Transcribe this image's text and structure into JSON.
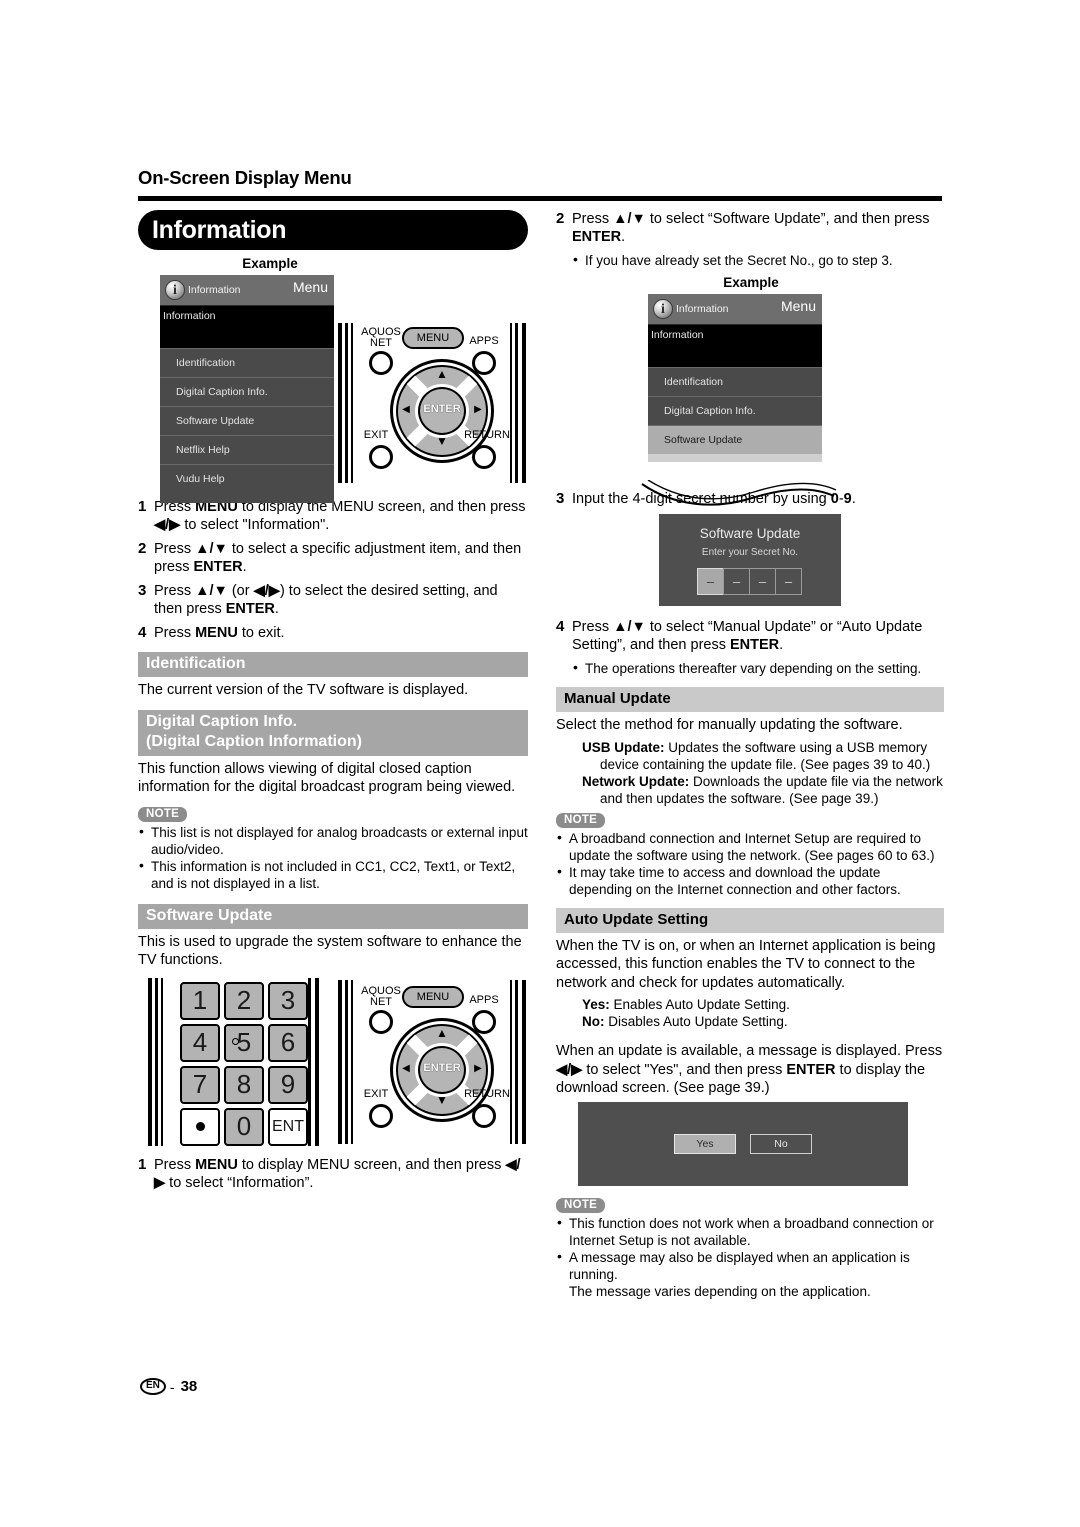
{
  "header": {
    "running_head": "On-Screen Display Menu"
  },
  "banner": {
    "title": "Information"
  },
  "labels": {
    "example": "Example",
    "note": "NOTE"
  },
  "osd_left": {
    "title_item": "Information",
    "title_menu": "Menu",
    "black_row": "Information",
    "rows": [
      "Identification",
      "Digital Caption Info.",
      "Software Update",
      "Netflix Help",
      "Vudu Help"
    ],
    "selected_index": -1
  },
  "osd_right": {
    "title_item": "Information",
    "title_menu": "Menu",
    "black_row": "Information",
    "rows": [
      "Identification",
      "Digital Caption Info.",
      "Software Update"
    ],
    "selected_index": 2
  },
  "remote": {
    "aquos_net_line1": "AQUOS",
    "aquos_net_line2": "NET",
    "menu": "MENU",
    "apps": "APPS",
    "exit": "EXIT",
    "return": "RETURN",
    "enter": "ENTER",
    "up_arrow": "▲",
    "down_arrow": "▼",
    "left_arrow": "◀",
    "right_arrow": "▶"
  },
  "keypad": {
    "keys": [
      "1",
      "2",
      "3",
      "4",
      "5",
      "6",
      "7",
      "8",
      "9",
      "•",
      "0",
      "ENT"
    ]
  },
  "left_steps": [
    {
      "num": "1",
      "text": "Press MENU to display the MENU screen, and then press ◀/▶ to select \"Information\"."
    },
    {
      "num": "2",
      "text": "Press ▲/▼ to select a specific adjustment item, and then press ENTER."
    },
    {
      "num": "3",
      "text": "Press ▲/▼ (or ◀/▶) to select the desired setting, and then press ENTER."
    },
    {
      "num": "4",
      "text": "Press MENU to exit."
    }
  ],
  "identification": {
    "heading": "Identification",
    "body": "The current version of the TV software is displayed."
  },
  "digital_caption": {
    "heading_line1": "Digital Caption Info.",
    "heading_line2": "(Digital Caption Information)",
    "body": "This function allows viewing of digital closed caption information for the digital broadcast program being viewed.",
    "notes": [
      "This list is not displayed for analog broadcasts or external input audio/video.",
      "This information is not included in CC1, CC2, Text1, or Text2, and is not displayed in a list."
    ]
  },
  "software_update_left": {
    "heading": "Software Update",
    "body": "This is used to upgrade the system software to enhance the TV functions.",
    "step": {
      "num": "1",
      "text": "Press MENU to display MENU screen, and then press ◀/▶ to select “Information”."
    }
  },
  "right_steps": {
    "step2": {
      "num": "2",
      "text": "Press ▲/▼ to select “Software Update”, and then press ENTER.",
      "bullet": "If you have already set the Secret No., go to step 3."
    },
    "step3": {
      "num": "3",
      "text": "Input the 4-digit secret number by using 0-9."
    },
    "step4": {
      "num": "4",
      "text": "Press ▲/▼ to select “Manual Update” or “Auto Update Setting”, and then press ENTER.",
      "bullet": "The operations thereafter vary depending on the setting."
    }
  },
  "secret_dialog": {
    "title": "Software Update",
    "subtitle": "Enter your Secret No.",
    "digits": [
      "–",
      "–",
      "–",
      "–"
    ],
    "active_index": 0
  },
  "manual_update": {
    "heading": "Manual Update",
    "body": "Select the method for manually updating the software.",
    "usb_label": "USB Update:",
    "usb_text": "Updates the software using a USB memory device containing the update file. (See pages 39 to 40.)",
    "network_label": "Network Update:",
    "network_text": "Downloads the update file via the network and then updates the software. (See page 39.)",
    "notes": [
      "A broadband connection and Internet Setup are required to update the software using the network. (See pages 60 to 63.)",
      "It may take time to access and download the update depending on the Internet connection and other factors."
    ]
  },
  "auto_update": {
    "heading": "Auto Update Setting",
    "body": "When the TV is on, or when an Internet application is being accessed, this function enables the TV to connect to the network and check for updates automatically.",
    "yes_label": "Yes:",
    "yes_text": "Enables Auto Update Setting.",
    "no_label": "No:",
    "no_text": "Disables Auto Update Setting.",
    "body2": "When an update is available, a message is displayed. Press ◀/▶ to select \"Yes\", and then press ENTER to display the download screen. (See page 39.)",
    "notes": [
      "This function does not work when a broadband connection or Internet Setup is not available.",
      "A message may also be displayed when an application is running."
    ],
    "note_extra": "The message varies depending on the application."
  },
  "yes_no_dialog": {
    "yes": "Yes",
    "no": "No",
    "selected": "Yes"
  },
  "footer": {
    "region": "EN",
    "dash": "-",
    "page": "38"
  },
  "colors": {
    "banner_bg": "#000000",
    "section_bar": "#a6a6a6",
    "section_bar_alt": "#c9c9c9",
    "osd_panel": "#4a4a4a",
    "osd_title": "#6e6e6e",
    "osd_selected": "#adadad",
    "dialog_bg": "#4f4f4f",
    "note_tag": "#8c8c8c"
  }
}
